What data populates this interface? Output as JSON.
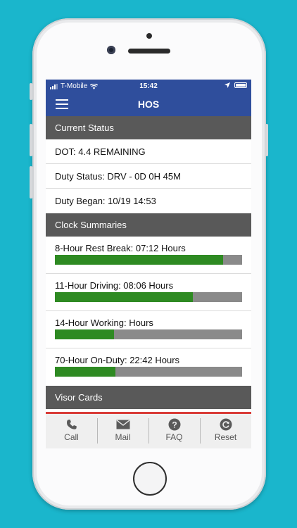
{
  "status_bar": {
    "carrier": "T-Mobile",
    "time": "15:42"
  },
  "header": {
    "title": "HOS"
  },
  "current_status": {
    "heading": "Current Status",
    "rows": [
      {
        "label": "DOT: 4.4 REMAINING"
      },
      {
        "label": "Duty Status: DRV - 0D 0H 45M"
      },
      {
        "label": "Duty Began: 10/19 14:53"
      }
    ]
  },
  "clock_summaries": {
    "heading": "Clock Summaries",
    "items": [
      {
        "label": "8-Hour Rest Break: 07:12 Hours",
        "progress": 0.9
      },
      {
        "label": "11-Hour Driving: 08:06 Hours",
        "progress": 0.736
      },
      {
        "label": "14-Hour Working: Hours",
        "progress": 0.316
      },
      {
        "label": "70-Hour On-Duty: 22:42 Hours",
        "progress": 0.324
      }
    ]
  },
  "visor_cards": {
    "heading": "Visor Cards"
  },
  "tabbar": {
    "tabs": [
      {
        "label": "Call",
        "icon": "phone-icon"
      },
      {
        "label": "Mail",
        "icon": "mail-icon"
      },
      {
        "label": "FAQ",
        "icon": "question-icon"
      },
      {
        "label": "Reset",
        "icon": "refresh-icon"
      }
    ]
  },
  "colors": {
    "background": "#1ab6cc",
    "nav_blue": "#2f4e9c",
    "section_gray": "#595959",
    "progress_green": "#2e8a22",
    "progress_track": "#8a8a8a",
    "tab_accent": "#d93b37"
  }
}
